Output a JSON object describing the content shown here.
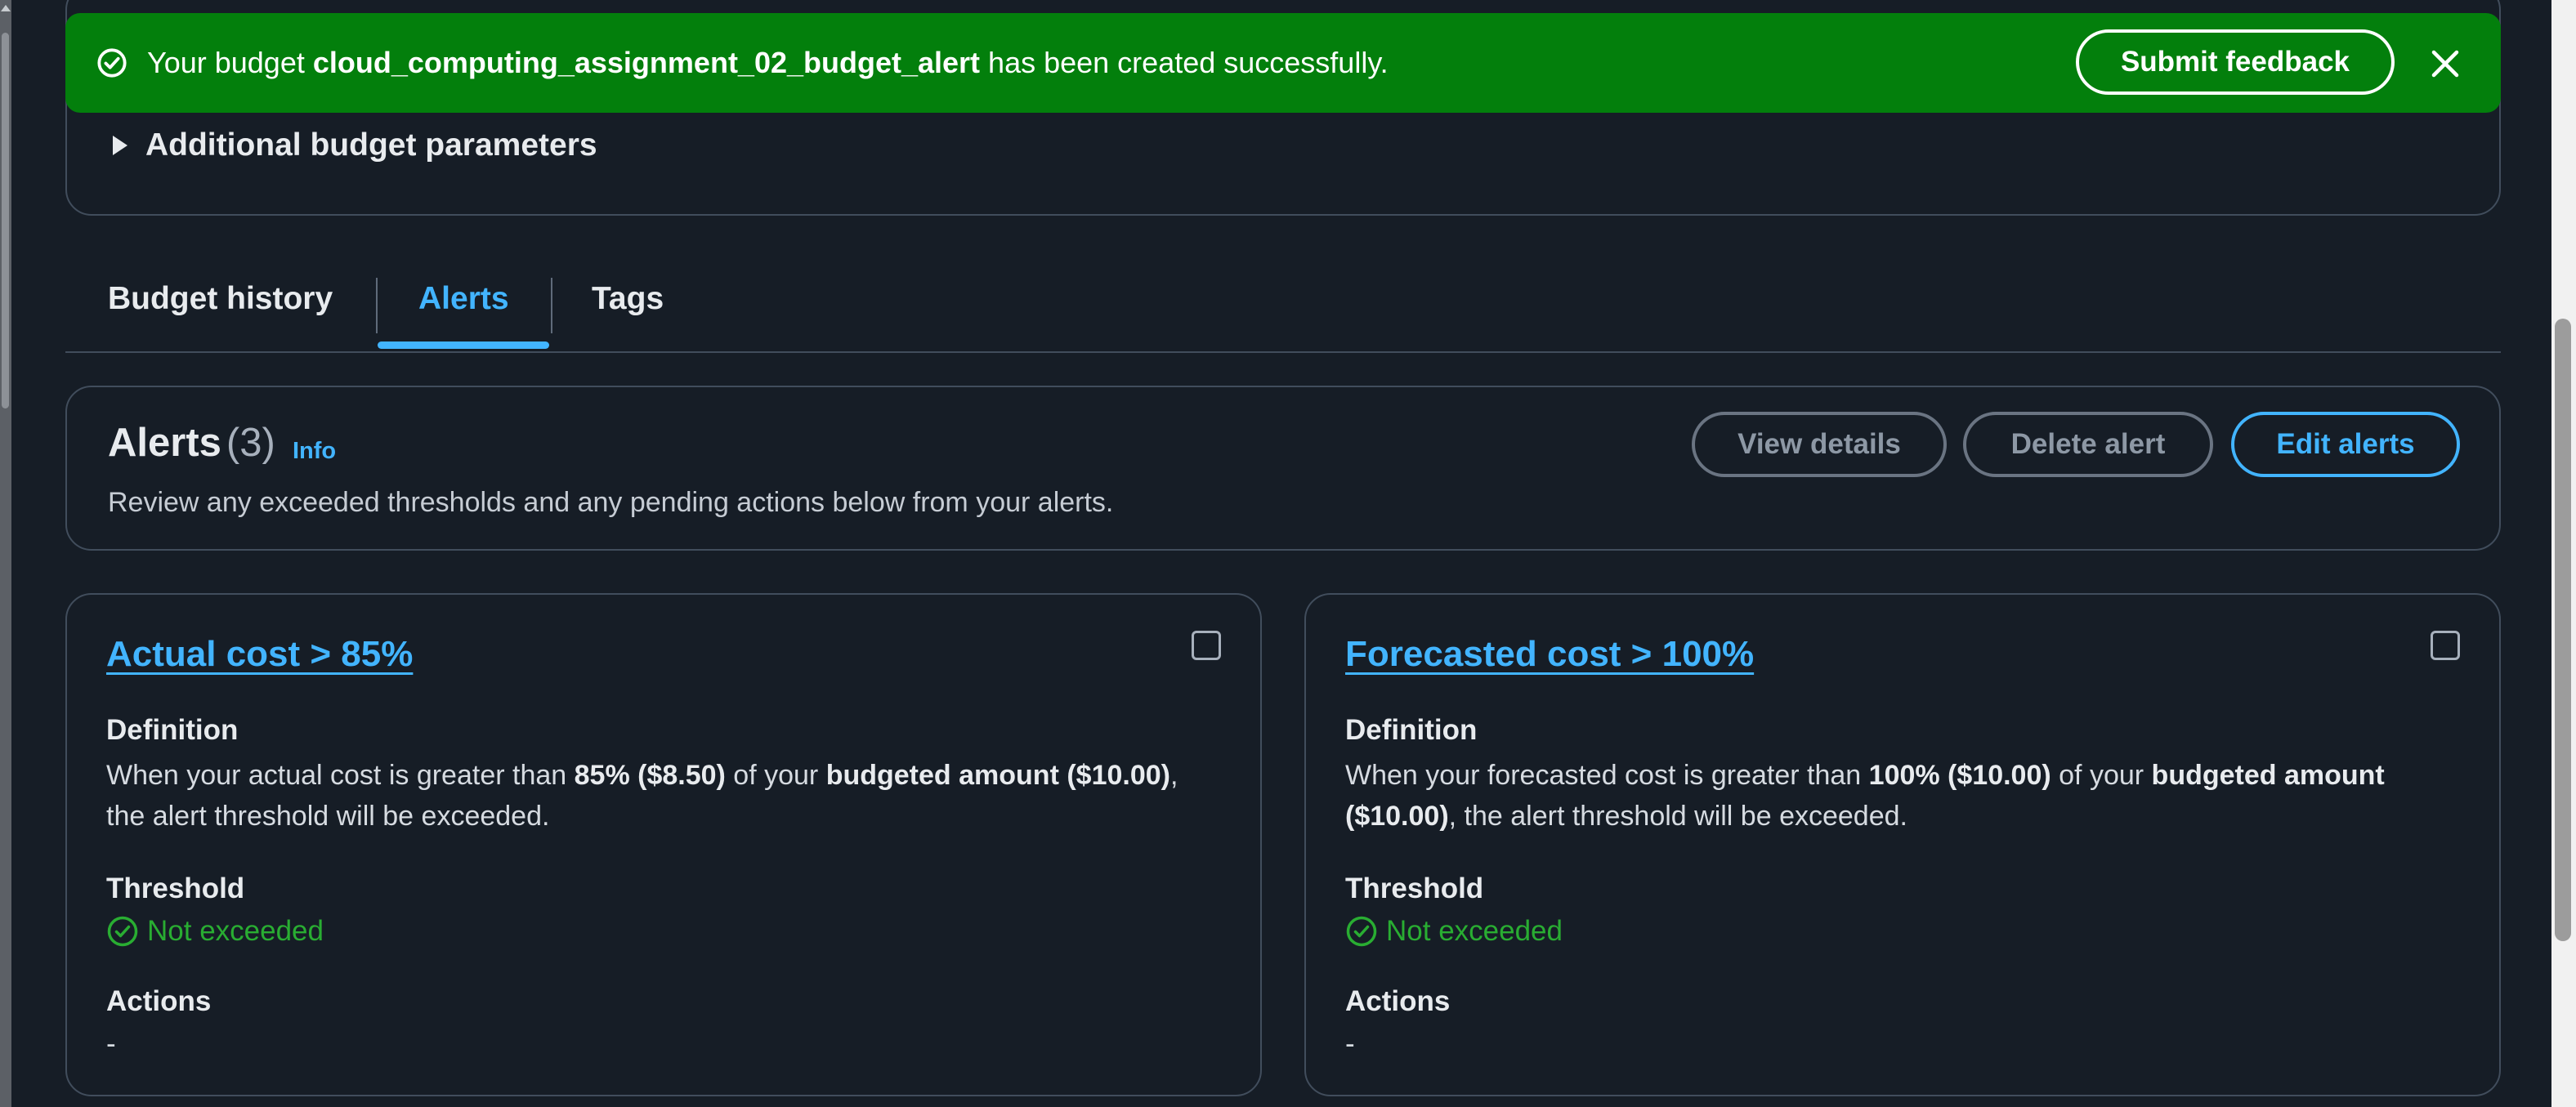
{
  "flash": {
    "prefix": "Your budget ",
    "budget_name": "cloud_computing_assignment_02_budget_alert",
    "suffix": " has been created successfully.",
    "feedback_button": "Submit feedback"
  },
  "params": {
    "label": "Additional budget parameters"
  },
  "tabs": [
    {
      "label": "Budget history",
      "active": false
    },
    {
      "label": "Alerts",
      "active": true
    },
    {
      "label": "Tags",
      "active": false
    }
  ],
  "alerts_header": {
    "title": "Alerts",
    "count": "(3)",
    "info": "Info",
    "description": "Review any exceeded thresholds and any pending actions below from your alerts.",
    "view_details": "View details",
    "delete_alert": "Delete alert",
    "edit_alerts": "Edit alerts"
  },
  "alerts": [
    {
      "title": "Actual cost > 85%",
      "definition_label": "Definition",
      "def_1": "When your actual cost is greater than ",
      "def_pct": "85% ($8.50)",
      "def_2": " of your ",
      "def_budget": "budgeted amount ($10.00)",
      "def_3": ", the alert threshold will be exceeded.",
      "threshold_label": "Threshold",
      "threshold_status": "Not exceeded",
      "actions_label": "Actions",
      "actions_value": "-"
    },
    {
      "title": "Forecasted cost > 100%",
      "definition_label": "Definition",
      "def_1": "When your forecasted cost is greater than ",
      "def_pct": "100% ($10.00)",
      "def_2": " of your ",
      "def_budget": "budgeted amount ($10.00)",
      "def_3": ", the alert threshold will be exceeded.",
      "threshold_label": "Threshold",
      "threshold_status": "Not exceeded",
      "actions_label": "Actions",
      "actions_value": "-"
    }
  ],
  "colors": {
    "background": "#161d26",
    "success_flash": "#037f0c",
    "accent": "#42b4ff",
    "status_ok": "#29ad32",
    "border": "#414d5c"
  },
  "icons": [
    "check-circle-icon",
    "close-icon",
    "caret-right-icon",
    "checkbox-icon"
  ]
}
